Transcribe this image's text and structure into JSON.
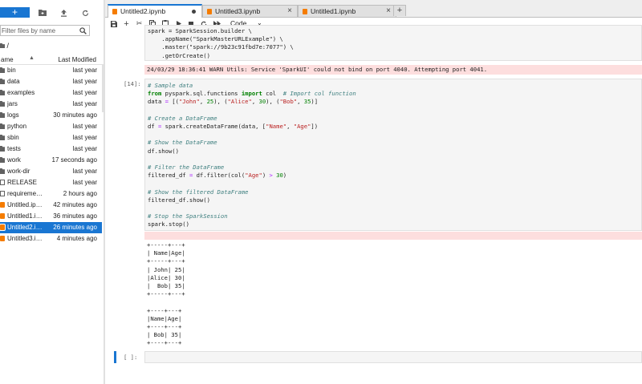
{
  "sidebar": {
    "new_label": "+",
    "filter_placeholder": "Filter files by name",
    "breadcrumb": "/",
    "col_name": "ame",
    "col_modified": "Last Modified",
    "files": [
      {
        "name": "bin",
        "modified": "last year",
        "type": "folder"
      },
      {
        "name": "data",
        "modified": "last year",
        "type": "folder"
      },
      {
        "name": "examples",
        "modified": "last year",
        "type": "folder"
      },
      {
        "name": "jars",
        "modified": "last year",
        "type": "folder"
      },
      {
        "name": "logs",
        "modified": "30 minutes ago",
        "type": "folder"
      },
      {
        "name": "python",
        "modified": "last year",
        "type": "folder"
      },
      {
        "name": "sbin",
        "modified": "last year",
        "type": "folder"
      },
      {
        "name": "tests",
        "modified": "last year",
        "type": "folder"
      },
      {
        "name": "work",
        "modified": "17 seconds ago",
        "type": "folder"
      },
      {
        "name": "work-dir",
        "modified": "last year",
        "type": "folder"
      },
      {
        "name": "RELEASE",
        "modified": "last year",
        "type": "file"
      },
      {
        "name": "requiremen...",
        "modified": "2 hours ago",
        "type": "file"
      },
      {
        "name": "Untitled.ipy...",
        "modified": "42 minutes ago",
        "type": "notebook"
      },
      {
        "name": "Untitled1.ip...",
        "modified": "36 minutes ago",
        "type": "notebook"
      },
      {
        "name": "Untitled2.ip...",
        "modified": "26 minutes ago",
        "type": "notebook",
        "selected": true
      },
      {
        "name": "Untitled3.ip...",
        "modified": "4 minutes ago",
        "type": "notebook"
      }
    ]
  },
  "tabs": [
    {
      "label": "Untitled2.ipynb",
      "active": true
    },
    {
      "label": "Untitled3.ipynb"
    },
    {
      "label": "Untitled1.ipynb"
    }
  ],
  "toolbar": {
    "cell_type": "Code"
  },
  "notebook": {
    "cell1_code": "spark = SparkSession.builder \\\n    .appName(\"SparkMasterURLExample\") \\\n    .master(\"spark://9b23c91fbd7e:7077\") \\\n    .getOrCreate()",
    "cell1_warning": "24/03/29 18:36:41 WARN Utils: Service 'SparkUI' could not bind on port 4040. Attempting port 4041.",
    "cell2_prompt": "[14]:",
    "cell2_code": "# Sample data\nfrom pyspark.sql.functions import col  # Import col function\ndata = [(\"John\", 25), (\"Alice\", 30), (\"Bob\", 35)]\n\n# Create a DataFrame\ndf = spark.createDataFrame(data, [\"Name\", \"Age\"])\n\n# Show the DataFrame\ndf.show()\n\n# Filter the DataFrame\nfiltered_df = df.filter(col(\"Age\") > 30)\n\n# Show the filtered DataFrame\nfiltered_df.show()\n\n# Stop the SparkSession\nspark.stop()",
    "cell2_output": "+-----+---+\n| Name|Age|\n+-----+---+\n| John| 25|\n|Alice| 30|\n|  Bob| 35|\n+-----+---+\n\n+----+---+\n|Name|Age|\n+----+---+\n| Bob| 35|\n+----+---+",
    "cell3_prompt": "[ ]:"
  }
}
